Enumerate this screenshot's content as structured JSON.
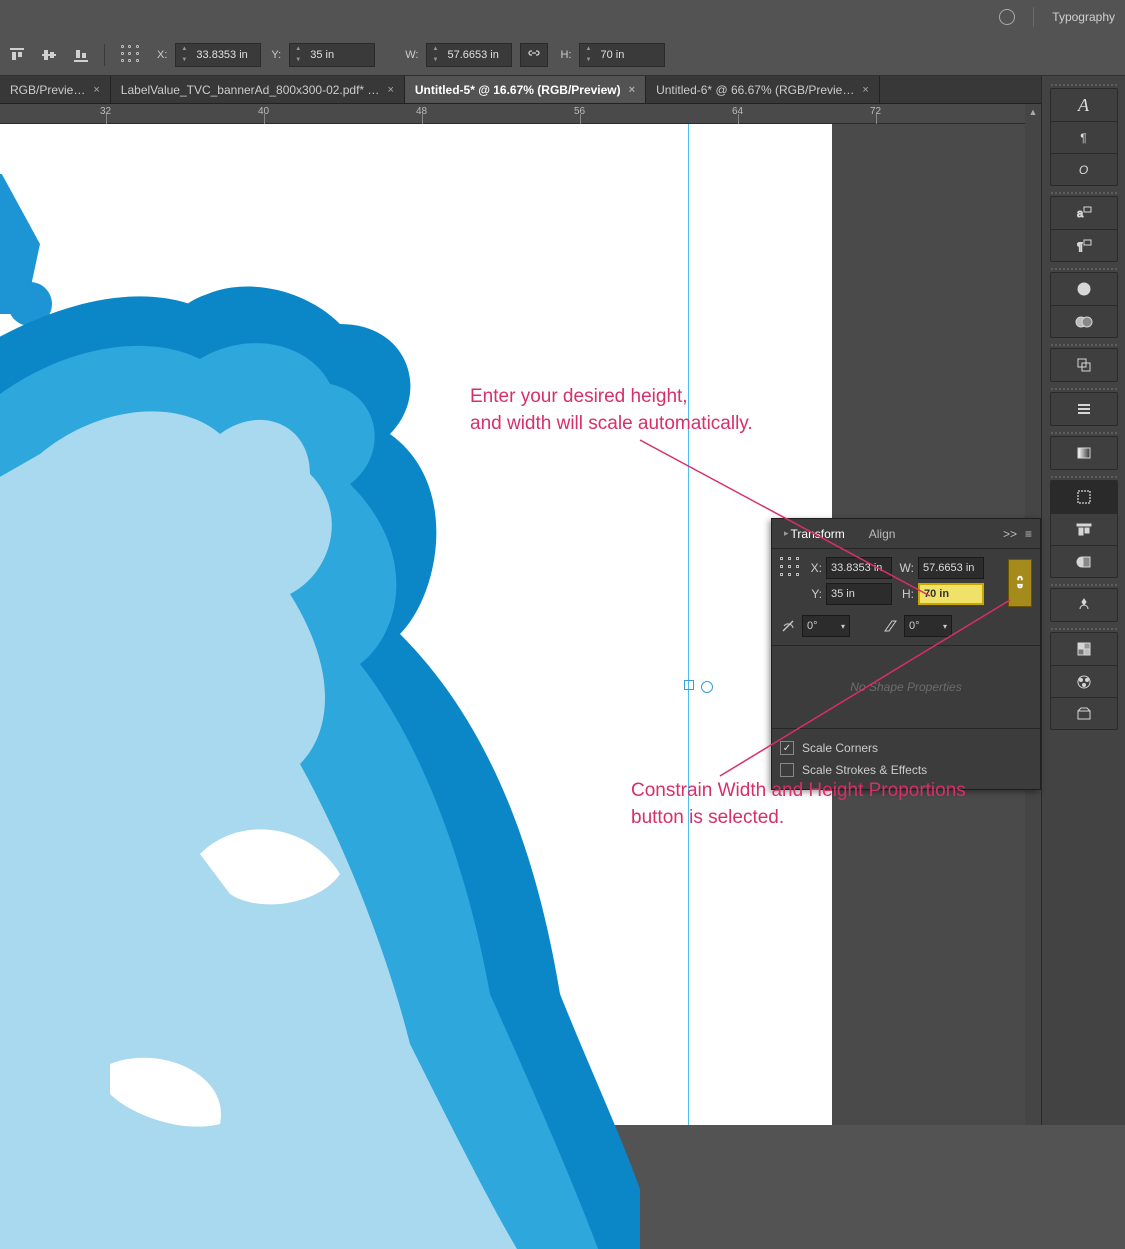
{
  "topmenu": {
    "typography": "Typography"
  },
  "optionsbar": {
    "x_label": "X:",
    "x_value": "33.8353 in",
    "y_label": "Y:",
    "y_value": "35 in",
    "w_label": "W:",
    "w_value": "57.6653 in",
    "h_label": "H:",
    "h_value": "70 in"
  },
  "tabs": {
    "t1": "RGB/Previe…",
    "t2": "LabelValue_TVC_bannerAd_800x300-02.pdf* …",
    "t3": "Untitled-5* @ 16.67% (RGB/Preview)",
    "t4": "Untitled-6* @ 66.67% (RGB/Previe…"
  },
  "ruler": {
    "r1": "32",
    "r2": "40",
    "r3": "48",
    "r4": "56",
    "r5": "64",
    "r6": "72"
  },
  "transform": {
    "tab_transform": "Transform",
    "tab_align": "Align",
    "menu_expand": ">>",
    "x_label": "X:",
    "x_value": "33.8353 in",
    "y_label": "Y:",
    "y_value": "35 in",
    "w_label": "W:",
    "w_value": "57.6653 in",
    "h_label": "H:",
    "h_value": "70 in",
    "rotate_value": "0°",
    "shear_value": "0°",
    "no_shape": "No Shape Properties",
    "scale_corners": "Scale Corners",
    "scale_strokes": "Scale Strokes & Effects"
  },
  "annotations": {
    "a1_l1": "Enter your desired height,",
    "a1_l2": "and width will scale automatically.",
    "a2_l1": "Constrain Width and Height Proportions",
    "a2_l2": "button is selected."
  },
  "icons": {
    "align_left": "align-left-icon",
    "align_center": "align-center-icon",
    "align_right": "align-right-icon",
    "char": "character-icon",
    "para": "paragraph-icon",
    "glyph": "glyph-icon",
    "charstyle": "characterstyles-icon",
    "parastyle": "paragraphstyles-icon",
    "appearance": "appearance-icon",
    "graphic": "graphicstyles-icon",
    "artboards": "artboards-icon",
    "stroke": "stroke-icon",
    "grad": "gradient-icon",
    "transform": "transform-icon",
    "align": "align-icon",
    "pathfinder": "pathfinder-icon",
    "symbols": "symbols-icon",
    "layers": "layers-icon",
    "swatches": "swatches-icon",
    "libraries": "libraries-icon",
    "export": "export-icon"
  }
}
